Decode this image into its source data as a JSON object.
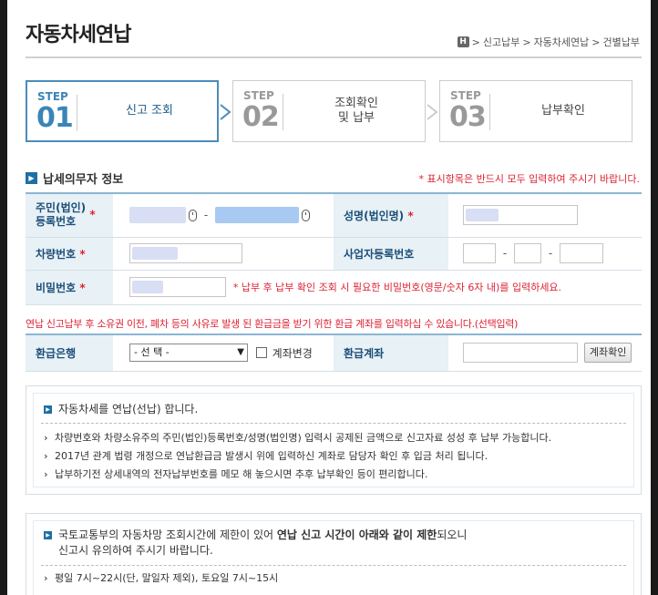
{
  "page": {
    "title": "자동차세연납"
  },
  "breadcrumb": {
    "home": "H",
    "items": [
      "신고납부",
      "자동차세연납",
      "건별납부"
    ],
    "sep": ">"
  },
  "steps": [
    {
      "label": "STEP",
      "num": "01",
      "text": "신고 조회",
      "active": true
    },
    {
      "label": "STEP",
      "num": "02",
      "text": "조회확인\n및 납부",
      "active": false
    },
    {
      "label": "STEP",
      "num": "03",
      "text": "납부확인",
      "active": false
    }
  ],
  "taxpayer": {
    "heading": "납세의무자 정보",
    "required_note": "* 표시항목은 반드시 모두 입력하여 주시기 바랍니다.",
    "resident_no_label": "주민(법인)\n등록번호",
    "name_label": "성명(법인명)",
    "car_no_label": "차량번호",
    "business_no_label": "사업자등록번호",
    "password_label": "비밀번호",
    "password_note": "* 납부 후 납부 확인 조회 시 필요한 비밀번호(영문/숫자 6자 내)를 입력하세요.",
    "req_mark": "*",
    "dash": "-"
  },
  "refund": {
    "note": "연납 신고납부 후 소유권 이전, 폐차 등의 사유로 발생 된 환급금을 받기 위한 환급 계좌를 입력하십 수 있습니다.(선택입력)",
    "bank_label": "환급은행",
    "bank_select": "- 선 택 -",
    "change_label": "계좌변경",
    "account_label": "환급계좌",
    "confirm_button": "계좌확인"
  },
  "info1": {
    "title": "자동차세를 연납(선납) 합니다.",
    "items": [
      "차량번호와 차량소유주의 주민(법인)등록번호/성명(법인명) 입력시 공제된 금액으로 신고자료 성성 후 납부 가능합니다.",
      "2017년 관계 법령 개정으로 연납환급금 발생시 위에 입력하신 계좌로 담당자 확인 후 입금 처리 됩니다.",
      "납부하기전 상세내역의 전자납부번호를 메모 해 놓으시면 추후 납부확인 등이 편리합니다."
    ]
  },
  "info2": {
    "title_a": "국토교통부의 자동차망 조회시간에 제한이 있어 ",
    "title_b": "연납 신고 시간이 아래와 같이 제한",
    "title_c": "되오니",
    "title_d": "신고시 유의하여 주시기 바랍니다.",
    "items": [
      "평일 7시~22시(단, 말일자 제외), 토요일 7시~15시"
    ]
  },
  "colors": {
    "accent": "#3a85b7",
    "required": "#d22233",
    "header_bg": "#e7f1f6"
  }
}
